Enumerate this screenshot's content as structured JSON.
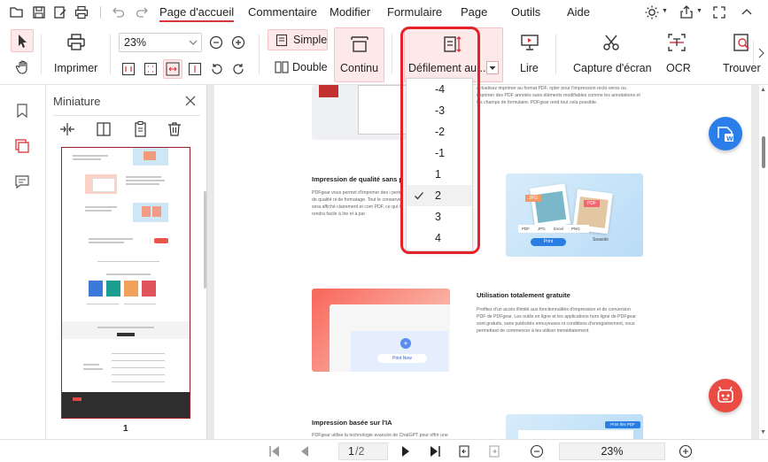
{
  "menubar": {
    "items": [
      {
        "label": "Page d'accueil"
      },
      {
        "label": "Commentaire"
      },
      {
        "label": "Modifier"
      },
      {
        "label": "Formulaire"
      },
      {
        "label": "Page"
      },
      {
        "label": "Outils"
      },
      {
        "label": "Aide"
      }
    ]
  },
  "ribbon": {
    "print_label": "Imprimer",
    "zoom_value": "23%",
    "simple_label": "Simple",
    "double_label": "Double",
    "continuous_label": "Continu",
    "scroll_label": "Défilement au...",
    "read_label": "Lire",
    "capture_label": "Capture d'écran",
    "ocr_label": "OCR",
    "find_label": "Trouver"
  },
  "thumbnails": {
    "title": "Miniature",
    "page_number": "1"
  },
  "dropdown": {
    "options": [
      "-4",
      "-3",
      "-2",
      "-1",
      "1",
      "2",
      "3",
      "4"
    ],
    "selected": "2"
  },
  "document": {
    "sec1_text": "actualisez imprimer au format PDF, opter pour l'impression recto verso ou imprimer des PDF annotés sans éléments modifiables comme les annotations et les champs de formulaire. PDFgear rend tout cela possible.",
    "sec2_title": "Impression de qualité sans p",
    "sec2_text": "PDFgear vous permet d'imprimer des i perte de qualité ni de formatage. Tout le conserver sera affiché clairement et com PDF, ce qui le rendra facile à lire et à par",
    "sec2_img_tags": [
      "JPG",
      "PDF"
    ],
    "sec2_img_tabs": [
      "PDF",
      "JPG",
      "Excel",
      "PNG"
    ],
    "sec2_img_btn": "Print",
    "sec2_img_caption": "Seaside",
    "sec3_title": "Utilisation totalement gratuite",
    "sec3_text": "Profitez d'un accès illimité aux fonctionnalités d'impression et de conversion PDF de PDFgear. Les outils en ligne et les applications hors ligne de PDFgear sont gratuits, sans publicités ennuyeuses ni conditions d'enregistrement, vous permettant de commencer à les utiliser immédiatement.",
    "sec3_btn": "Print Now",
    "sec4_title": "Impression basée sur l'IA",
    "sec4_text": "PDFgear utilise la technologie avancée de ChatGPT pour offrir une",
    "sec4_btn": "Print this PDF"
  },
  "statusbar": {
    "page_current": "1",
    "page_total": "/2",
    "zoom": "23%"
  },
  "colors": {
    "accent": "#d8343b",
    "highlight_bg": "#fde9ea",
    "blue_fab": "#2b7de9",
    "red_fab": "#ea4b43"
  }
}
